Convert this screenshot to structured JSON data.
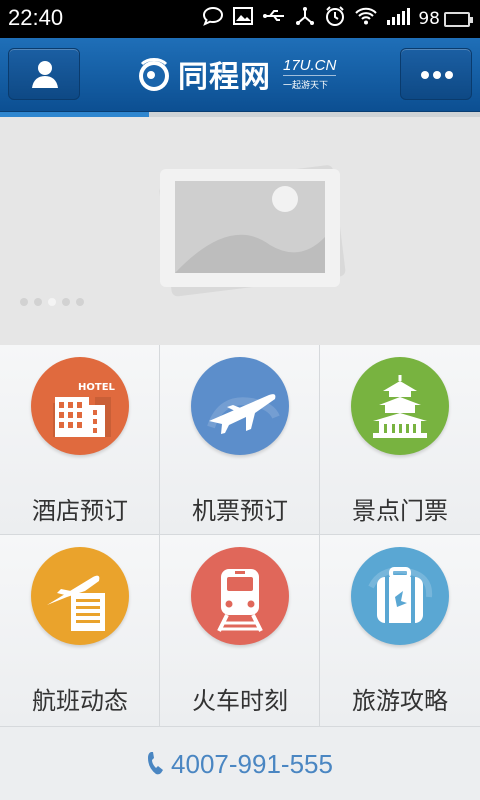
{
  "status_bar": {
    "time": "22:40",
    "battery_percent": "98",
    "battery_level": 0.98,
    "icons": [
      "chat-bubble-icon",
      "image-icon",
      "usb-icon",
      "share-icon",
      "alarm-icon",
      "wifi-icon",
      "signal-icon",
      "battery-icon"
    ]
  },
  "header": {
    "logo_text": "同程网",
    "logo_domain": "17U.CN",
    "logo_slogan": "一起游天下",
    "left_button_icon": "user-icon",
    "right_button_icon": "more-icon"
  },
  "progress": {
    "value": 0.31
  },
  "banner": {
    "placeholder_icon": "image-placeholder-icon",
    "dots": 5,
    "active_dot": 2
  },
  "menu": [
    {
      "label": "酒店预订",
      "icon": "hotel-icon",
      "color": "#e06a3e",
      "icon_text": "HOTEL"
    },
    {
      "label": "机票预订",
      "icon": "airplane-icon",
      "color": "#5c8ecb"
    },
    {
      "label": "景点门票",
      "icon": "temple-icon",
      "color": "#78b340"
    },
    {
      "label": "航班动态",
      "icon": "flight-status-icon",
      "color": "#eaa32c"
    },
    {
      "label": "火车时刻",
      "icon": "train-icon",
      "color": "#e0675a"
    },
    {
      "label": "旅游攻略",
      "icon": "luggage-icon",
      "color": "#5aa7d3"
    }
  ],
  "footer": {
    "phone": "4007-991-555",
    "phone_icon": "phone-icon"
  },
  "colors": {
    "header_blue": "#1a64ab",
    "accent_blue": "#2f86cf",
    "phone_blue": "#4a86c2"
  }
}
